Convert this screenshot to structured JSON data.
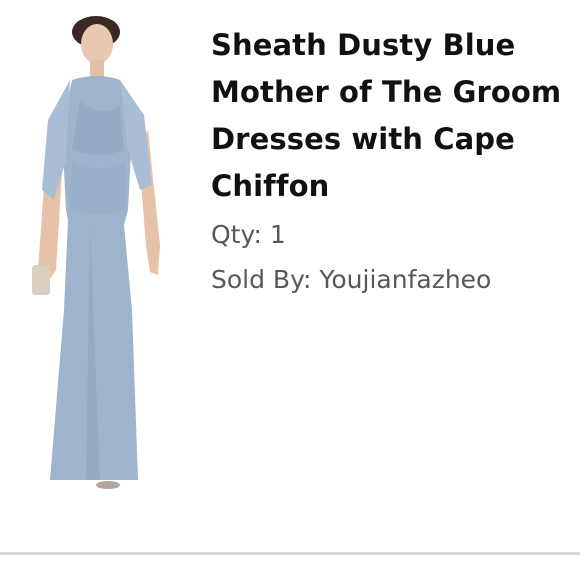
{
  "item": {
    "title": "Sheath Dusty Blue Mother of The Groom Dresses with Cape Chiffon",
    "qty_label": "Qty: 1",
    "sold_by_label": "Sold By: Youjianfazheo",
    "image_description": "product-photo-dress"
  },
  "colors": {
    "dress": "#9db4cc",
    "dress_shadow": "#86a0bb",
    "divider": "#d5d9d9",
    "meta_text": "#565959"
  }
}
